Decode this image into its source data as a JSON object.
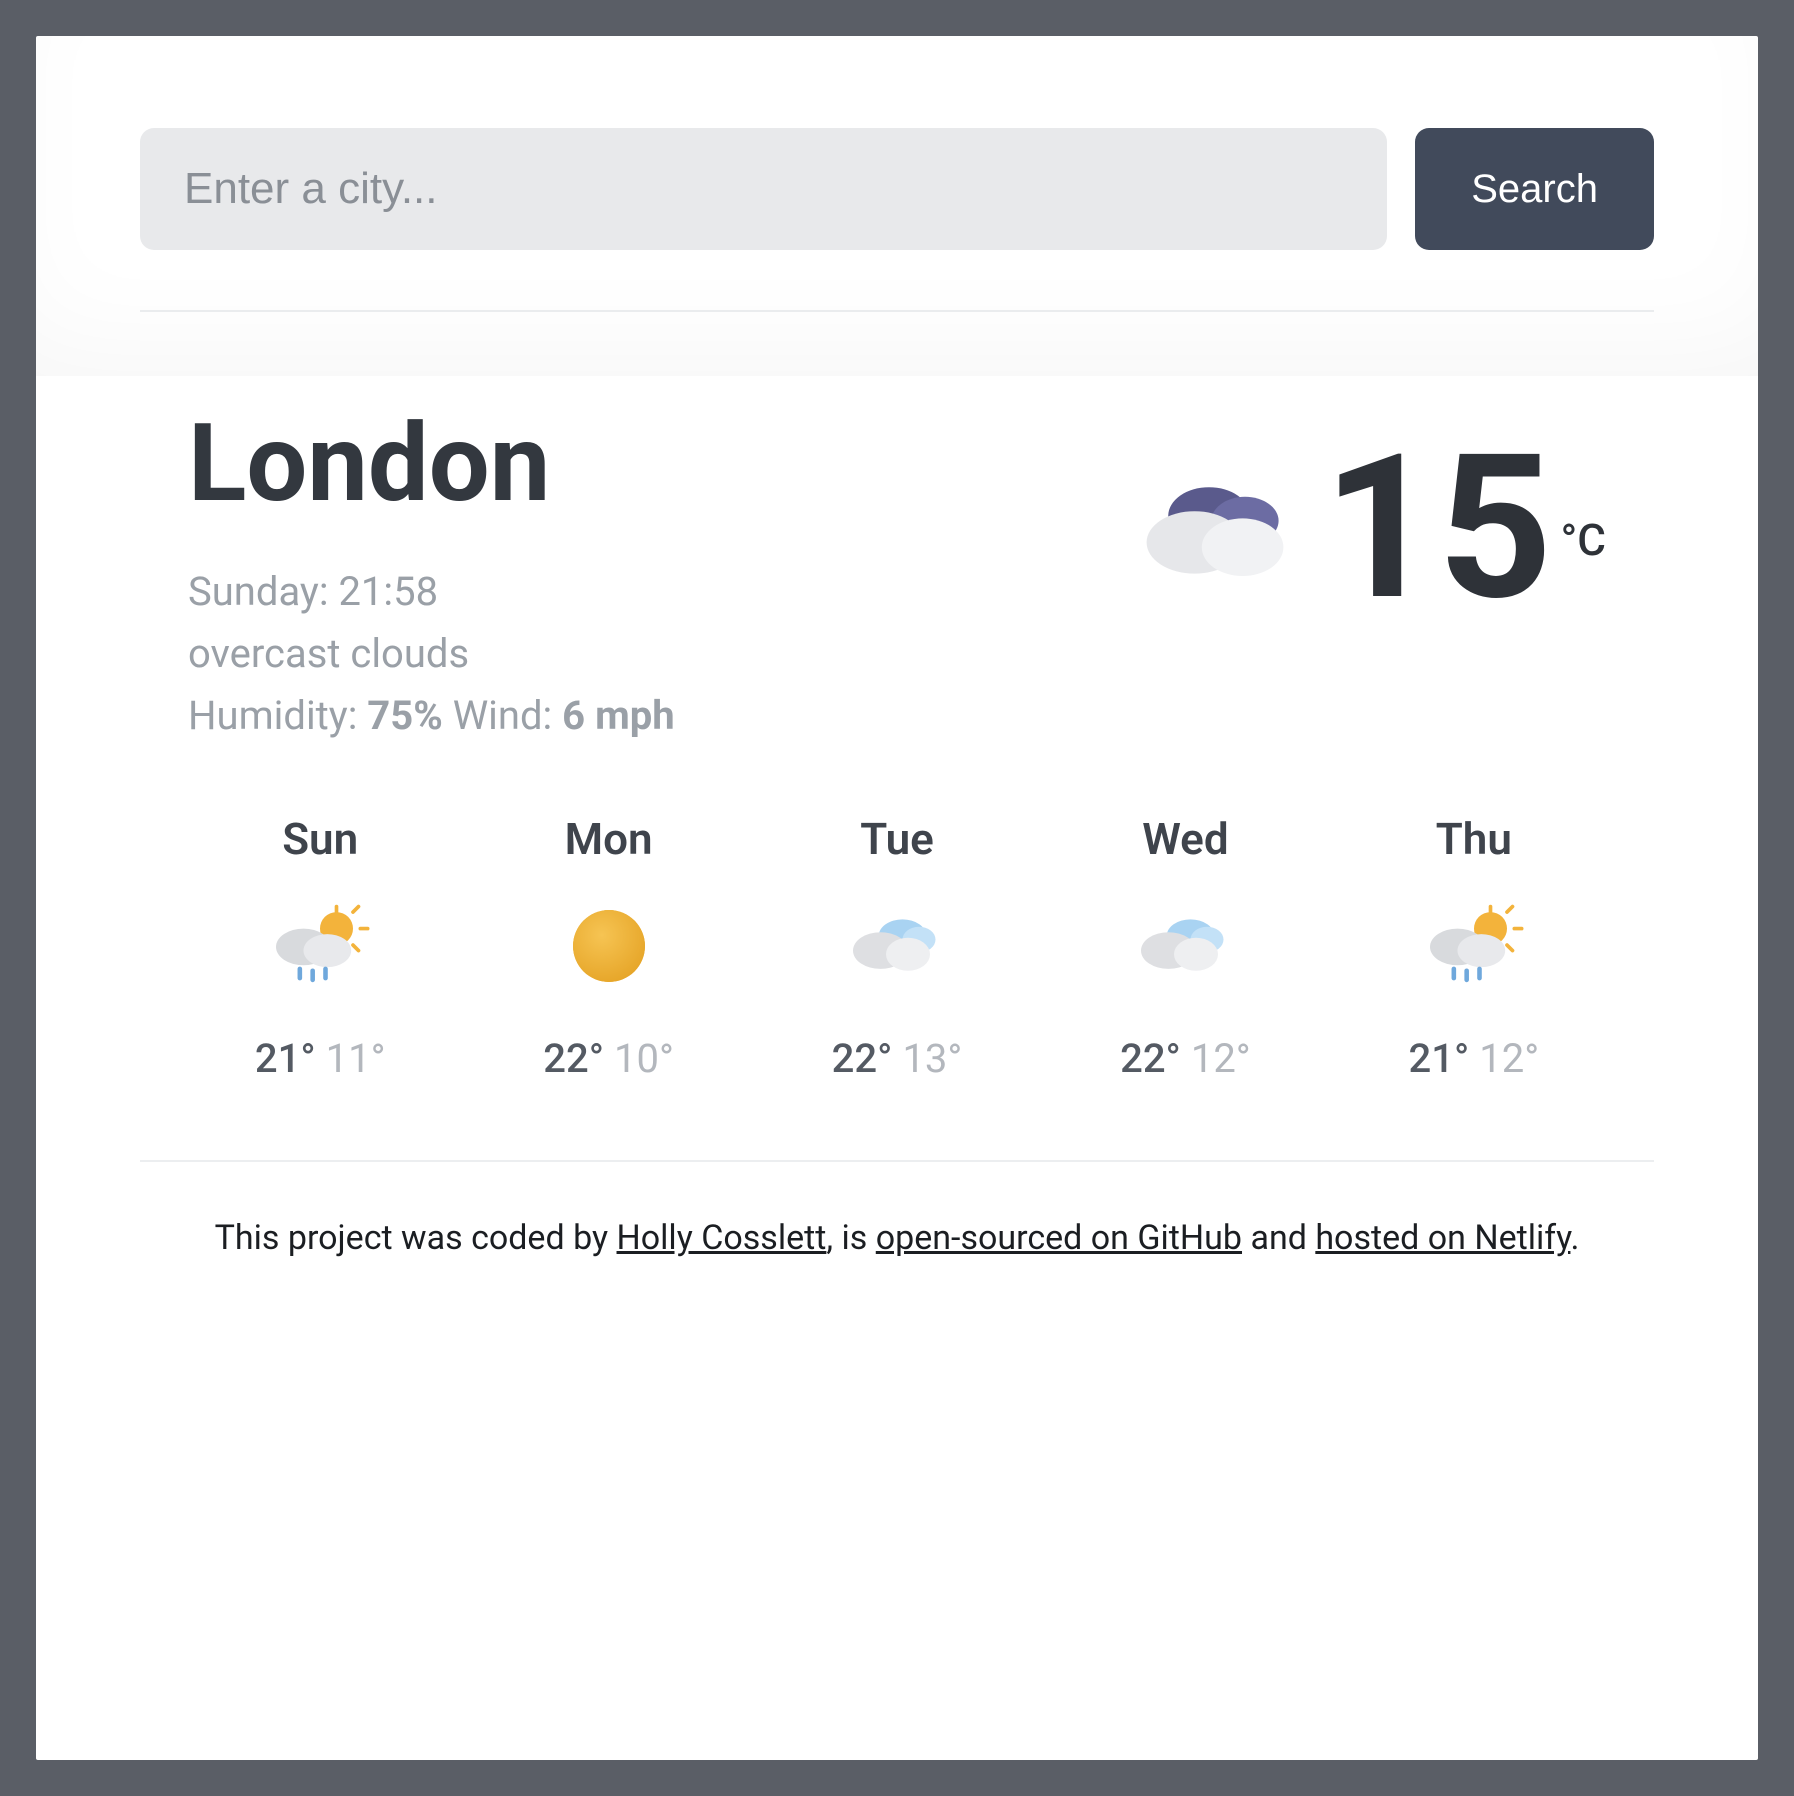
{
  "search": {
    "placeholder": "Enter a city...",
    "button_label": "Search"
  },
  "current": {
    "city": "London",
    "datetime": "Sunday: 21:58",
    "description": "overcast clouds",
    "humidity_label": "Humidity: ",
    "humidity_value": "75%",
    "wind_label": " Wind: ",
    "wind_value": "6 mph",
    "temp": "15",
    "unit": "°C",
    "icon": "overcast-icon"
  },
  "forecast": [
    {
      "day": "Sun",
      "icon": "rain-sun-icon",
      "hi": "21°",
      "lo": "11°"
    },
    {
      "day": "Mon",
      "icon": "sunny-icon",
      "hi": "22°",
      "lo": "10°"
    },
    {
      "day": "Tue",
      "icon": "cloudy-icon",
      "hi": "22°",
      "lo": "13°"
    },
    {
      "day": "Wed",
      "icon": "cloudy-icon",
      "hi": "22°",
      "lo": "12°"
    },
    {
      "day": "Thu",
      "icon": "rain-sun-icon",
      "hi": "21°",
      "lo": "12°"
    }
  ],
  "footer": {
    "pre": "This project was coded by ",
    "author": "Holly Cosslett",
    "mid1": ", is ",
    "link1": "open-sourced on GitHub",
    "mid2": " and ",
    "link2": "hosted on Netlify",
    "end": "."
  }
}
